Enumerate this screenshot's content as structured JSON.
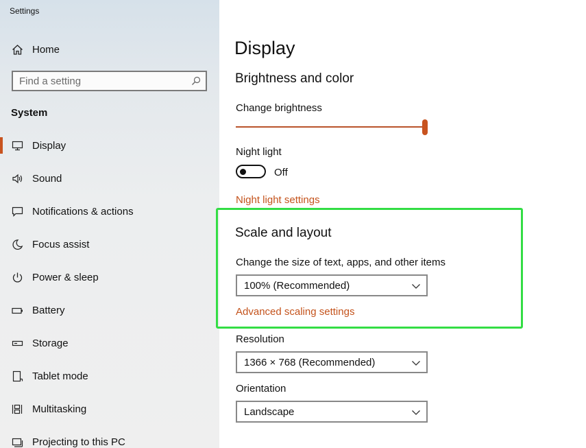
{
  "window": {
    "title": "Settings"
  },
  "sidebar": {
    "home_label": "Home",
    "search": {
      "placeholder": "Find a setting",
      "value": ""
    },
    "section_label": "System",
    "items": [
      {
        "label": "Display",
        "icon": "monitor-icon"
      },
      {
        "label": "Sound",
        "icon": "speaker-icon"
      },
      {
        "label": "Notifications & actions",
        "icon": "notification-icon"
      },
      {
        "label": "Focus assist",
        "icon": "moon-icon"
      },
      {
        "label": "Power & sleep",
        "icon": "power-icon"
      },
      {
        "label": "Battery",
        "icon": "battery-icon"
      },
      {
        "label": "Storage",
        "icon": "storage-icon"
      },
      {
        "label": "Tablet mode",
        "icon": "tablet-icon"
      },
      {
        "label": "Multitasking",
        "icon": "multitasking-icon"
      },
      {
        "label": "Projecting to this PC",
        "icon": "projecting-icon"
      }
    ],
    "selected": "Display"
  },
  "main": {
    "title": "Display",
    "brightness_section": {
      "heading": "Brightness and color",
      "brightness_label": "Change brightness",
      "brightness_value_fraction": 1.0,
      "night_light_label": "Night light",
      "night_light_state": "Off",
      "night_light_link": "Night light settings"
    },
    "scale_section": {
      "heading": "Scale and layout",
      "scale_label": "Change the size of text, apps, and other items",
      "scale_value": "100% (Recommended)",
      "advanced_link": "Advanced scaling settings",
      "resolution_label": "Resolution",
      "resolution_value": "1366 × 768 (Recommended)",
      "orientation_label": "Orientation",
      "orientation_value": "Landscape"
    }
  },
  "colors": {
    "accent": "#c8531f",
    "link": "#c4531c",
    "highlight": "#33dd44"
  }
}
